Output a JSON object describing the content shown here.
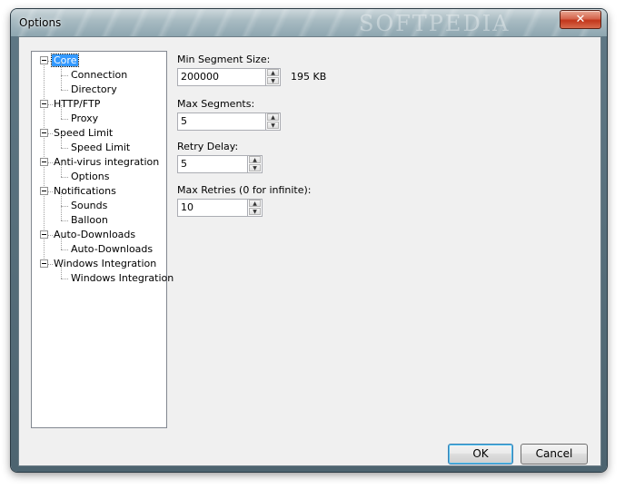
{
  "window": {
    "title": "Options",
    "watermark": "SOFTPEDIA",
    "close_glyph": "✕"
  },
  "tree": [
    {
      "label": "Core",
      "level": 0,
      "selected": true
    },
    {
      "label": "Connection",
      "level": 1
    },
    {
      "label": "Directory",
      "level": 1
    },
    {
      "label": "HTTP/FTP",
      "level": 0
    },
    {
      "label": "Proxy",
      "level": 1
    },
    {
      "label": "Speed Limit",
      "level": 0
    },
    {
      "label": "Speed Limit",
      "level": 1
    },
    {
      "label": "Anti-virus integration",
      "level": 0
    },
    {
      "label": "Options",
      "level": 1
    },
    {
      "label": "Notifications",
      "level": 0
    },
    {
      "label": "Sounds",
      "level": 1
    },
    {
      "label": "Balloon",
      "level": 1
    },
    {
      "label": "Auto-Downloads",
      "level": 0
    },
    {
      "label": "Auto-Downloads",
      "level": 1
    },
    {
      "label": "Windows Integration",
      "level": 0
    },
    {
      "label": "Windows Integration",
      "level": 1
    }
  ],
  "fields": {
    "min_segment": {
      "label": "Min Segment Size:",
      "value": "200000",
      "suffix": "195 KB"
    },
    "max_segments": {
      "label": "Max Segments:",
      "value": "5"
    },
    "retry_delay": {
      "label": "Retry Delay:",
      "value": "5"
    },
    "max_retries": {
      "label": "Max Retries (0 for infinite):",
      "value": "10"
    }
  },
  "buttons": {
    "ok": "OK",
    "cancel": "Cancel"
  },
  "icons": {
    "spin_up": "▲",
    "spin_down": "▼"
  }
}
